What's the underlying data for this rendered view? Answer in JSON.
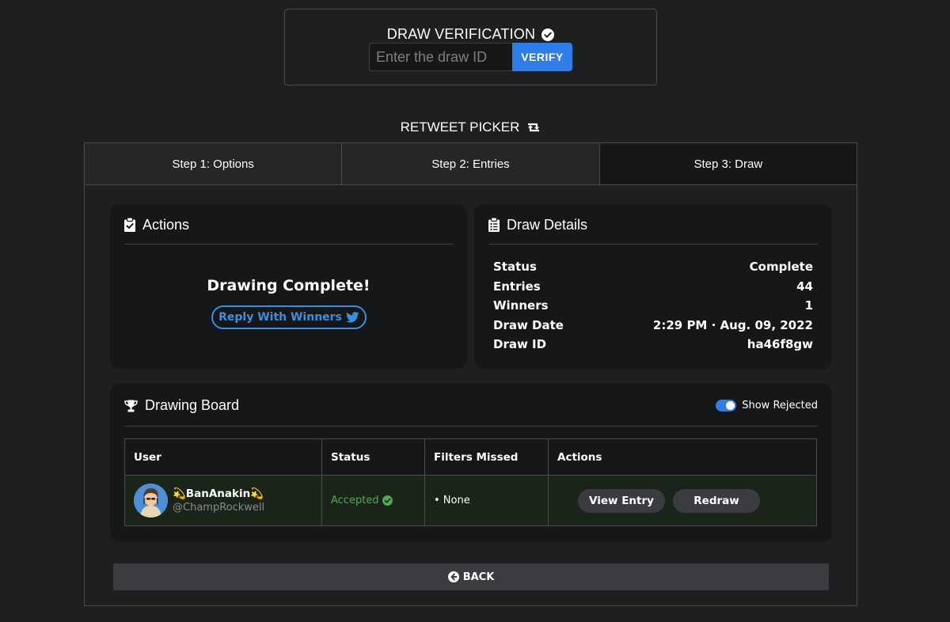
{
  "verification": {
    "title": "DRAW VERIFICATION",
    "title_icon": "check-circle-icon",
    "input_placeholder": "Enter the draw ID",
    "input_value": "",
    "verify_label": "VERIFY"
  },
  "picker": {
    "title": "RETWEET PICKER",
    "title_icon": "retweet-icon"
  },
  "tabs": [
    {
      "label": "Step 1: Options",
      "active": false
    },
    {
      "label": "Step 2: Entries",
      "active": false
    },
    {
      "label": "Step 3: Draw",
      "active": true
    }
  ],
  "actions_card": {
    "title": "Actions",
    "icon": "clipboard-check-icon",
    "message": "Drawing Complete!",
    "reply_label": "Reply With Winners",
    "reply_icon": "twitter-icon"
  },
  "details_card": {
    "title": "Draw Details",
    "icon": "clipboard-list-icon",
    "rows": [
      {
        "label": "Status",
        "value": "Complete"
      },
      {
        "label": "Entries",
        "value": "44"
      },
      {
        "label": "Winners",
        "value": "1"
      },
      {
        "label": "Draw Date",
        "value": "2:29 PM · Aug. 09, 2022"
      },
      {
        "label": "Draw ID",
        "value": "ha46f8gw"
      }
    ]
  },
  "board": {
    "title": "Drawing Board",
    "icon": "trophy-icon",
    "toggle_label": "Show Rejected",
    "toggle_on": true,
    "columns": [
      "User",
      "Status",
      "Filters Missed",
      "Actions"
    ],
    "rows": [
      {
        "name": "💫BanAnakin💫",
        "handle": "@ChampRockwell",
        "status": "Accepted",
        "filters_missed": "• None",
        "view_label": "View Entry",
        "redraw_label": "Redraw"
      }
    ]
  },
  "back_label": "BACK",
  "colors": {
    "background": "#1e1f20",
    "card": "#161718",
    "accent": "#2f7de9",
    "twitter_blue": "#3a8fe0",
    "accepted_green": "#4cae4c"
  }
}
